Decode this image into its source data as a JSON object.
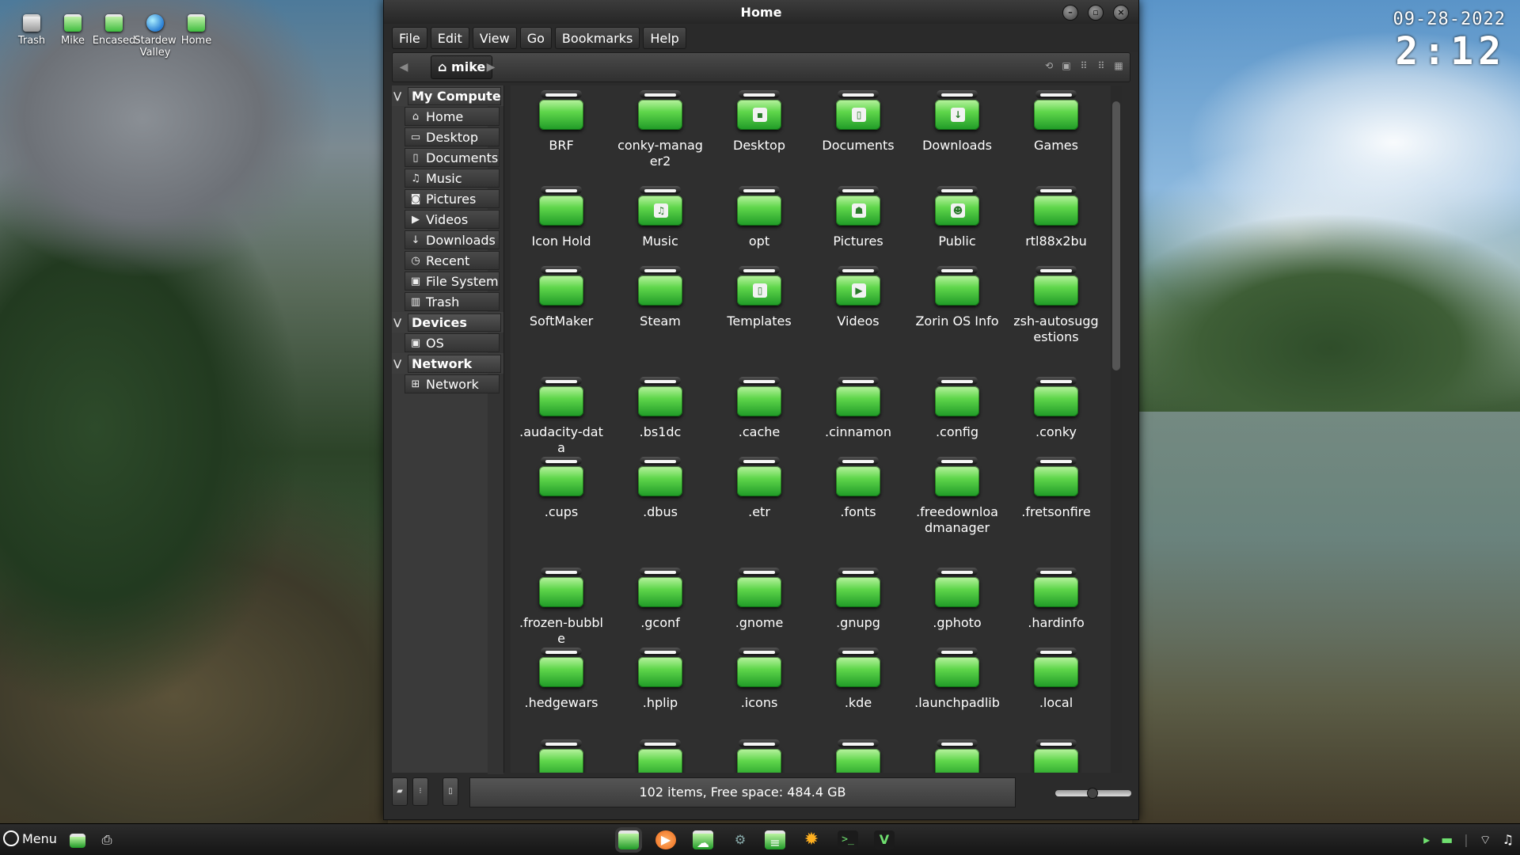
{
  "desktop_icons": [
    {
      "label": "Trash"
    },
    {
      "label": "Mike"
    },
    {
      "label": "Encased"
    },
    {
      "label": "Stardew Valley"
    },
    {
      "label": "Home"
    }
  ],
  "clock": {
    "date": "09-28-2022",
    "time": "2:12"
  },
  "window": {
    "title": "Home",
    "menu": [
      "File",
      "Edit",
      "View",
      "Go",
      "Bookmarks",
      "Help"
    ],
    "location": "mike",
    "sidebar": {
      "sections": [
        {
          "label": "My Computer",
          "items": [
            {
              "label": "Home",
              "icon": "home-icon",
              "glyph": "⌂"
            },
            {
              "label": "Desktop",
              "icon": "desktop-icon",
              "glyph": "▭"
            },
            {
              "label": "Documents",
              "icon": "document-icon",
              "glyph": "▯"
            },
            {
              "label": "Music",
              "icon": "music-icon",
              "glyph": "♫"
            },
            {
              "label": "Pictures",
              "icon": "camera-icon",
              "glyph": "◙"
            },
            {
              "label": "Videos",
              "icon": "video-icon",
              "glyph": "▶"
            },
            {
              "label": "Downloads",
              "icon": "download-icon",
              "glyph": "↓"
            },
            {
              "label": "Recent",
              "icon": "clock-icon",
              "glyph": "◷"
            },
            {
              "label": "File System",
              "icon": "filesystem-icon",
              "glyph": "▣"
            },
            {
              "label": "Trash",
              "icon": "trash-icon",
              "glyph": "▥"
            }
          ]
        },
        {
          "label": "Devices",
          "items": [
            {
              "label": "OS",
              "icon": "drive-icon",
              "glyph": "▣"
            }
          ]
        },
        {
          "label": "Network",
          "items": [
            {
              "label": "Network",
              "icon": "network-icon",
              "glyph": "⊞"
            }
          ]
        }
      ]
    },
    "files": [
      {
        "name": "BRF"
      },
      {
        "name": "conky-manager2"
      },
      {
        "name": "Desktop",
        "emblem": "▪"
      },
      {
        "name": "Documents",
        "emblem": "▯"
      },
      {
        "name": "Downloads",
        "emblem": "↓"
      },
      {
        "name": "Games"
      },
      {
        "name": "Icon Hold"
      },
      {
        "name": "Music",
        "emblem": "♫"
      },
      {
        "name": "opt"
      },
      {
        "name": "Pictures",
        "emblem": "☗"
      },
      {
        "name": "Public",
        "emblem": "☻"
      },
      {
        "name": "rtl88x2bu"
      },
      {
        "name": "SoftMaker"
      },
      {
        "name": "Steam"
      },
      {
        "name": "Templates",
        "emblem": "▯"
      },
      {
        "name": "Videos",
        "emblem": "▶"
      },
      {
        "name": "Zorin OS Info"
      },
      {
        "name": "zsh-autosuggestions"
      },
      {
        "name": ".audacity-data"
      },
      {
        "name": ".bs1dc"
      },
      {
        "name": ".cache"
      },
      {
        "name": ".cinnamon"
      },
      {
        "name": ".config"
      },
      {
        "name": ".conky"
      },
      {
        "name": ".cups"
      },
      {
        "name": ".dbus"
      },
      {
        "name": ".etr"
      },
      {
        "name": ".fonts"
      },
      {
        "name": ".freedownloadmanager"
      },
      {
        "name": ".fretsonfire"
      },
      {
        "name": ".frozen-bubble"
      },
      {
        "name": ".gconf"
      },
      {
        "name": ".gnome"
      },
      {
        "name": ".gnupg"
      },
      {
        "name": ".gphoto"
      },
      {
        "name": ".hardinfo"
      },
      {
        "name": ".hedgewars"
      },
      {
        "name": ".hplip"
      },
      {
        "name": ".icons"
      },
      {
        "name": ".kde"
      },
      {
        "name": ".launchpadlib"
      },
      {
        "name": ".local"
      },
      {
        "name": ""
      },
      {
        "name": ""
      },
      {
        "name": ""
      },
      {
        "name": ""
      },
      {
        "name": ""
      },
      {
        "name": ""
      }
    ],
    "status": "102 items, Free space: 484.4 GB"
  },
  "taskbar": {
    "menu_label": "Menu",
    "apps": [
      {
        "icon": "file-manager-icon"
      },
      {
        "icon": "media-player-icon"
      },
      {
        "icon": "cloud-icon"
      },
      {
        "icon": "settings-icon"
      },
      {
        "icon": "text-editor-icon"
      },
      {
        "icon": "sun-gear-icon"
      },
      {
        "icon": "terminal-icon"
      },
      {
        "icon": "vim-icon"
      }
    ],
    "tray": [
      "terminal-tray-icon",
      "folder-tray-icon",
      "wifi-icon",
      "music-icon"
    ]
  },
  "colors": {
    "folder_green": "#5fd64b",
    "chrome": "#2b2b2b",
    "accent_orange": "#ef6a1a"
  }
}
